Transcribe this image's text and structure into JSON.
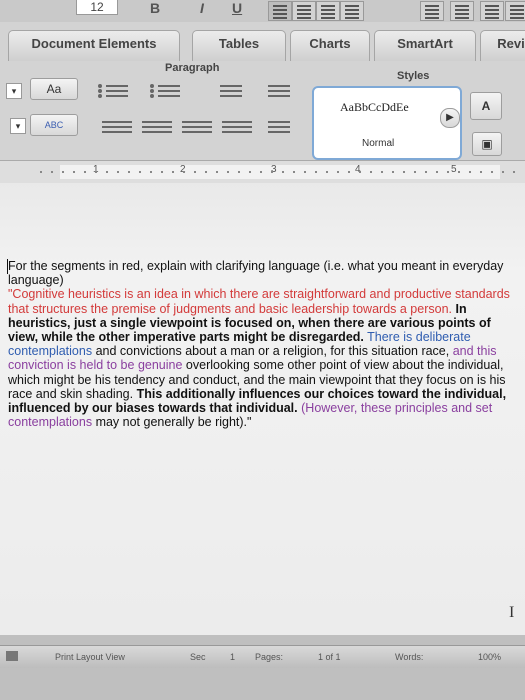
{
  "ribbon": {
    "font_size_value": "12",
    "bold_label": "B",
    "italic_label": "I",
    "underline_label": "U",
    "tabs": [
      "Document Elements",
      "Tables",
      "Charts",
      "SmartArt",
      "Revi"
    ],
    "groups": {
      "paragraph": "Paragraph",
      "styles": "Styles"
    },
    "font_case_label": "Aa",
    "highlight_label": "ABC",
    "style_sample": "AaBbCcDdEe",
    "style_name": "Normal"
  },
  "ruler": {
    "numbers": [
      "1",
      "2",
      "3",
      "4",
      "5"
    ]
  },
  "document": {
    "instruction": "For the segments in red, explain with clarifying language (i.e. what you meant in everyday language)",
    "s1": "\"Cognitive heuristics is an idea in which there are straightforward and productive standards that structures the premise of judgments and basic leadership towards a person.",
    "s2": "In heuristics, just a single viewpoint is focused on, when there are various points of view, while the other imperative parts might be disregarded.",
    "s3": "There is deliberate contemplations",
    "s4": "and convictions about a man or a religion, for this situation race,",
    "s5": "and this conviction is held to be genuine",
    "s6": "overlooking some other point of view about the individual, which might be his tendency and conduct, and the main viewpoint that they focus on is his race and skin shading.",
    "s7": "This additionally influences our choices toward the individual, influenced by our biases towards that individual.",
    "s8": "(However, these principles and set contemplations",
    "s9": "may not generally be right).\""
  },
  "status": {
    "view": "Print Layout View",
    "sec_label": "Sec",
    "sec_value": "1",
    "pages_label": "Pages:",
    "pages_value": "1 of 1",
    "words_label": "Words:",
    "zoom": "100%"
  }
}
